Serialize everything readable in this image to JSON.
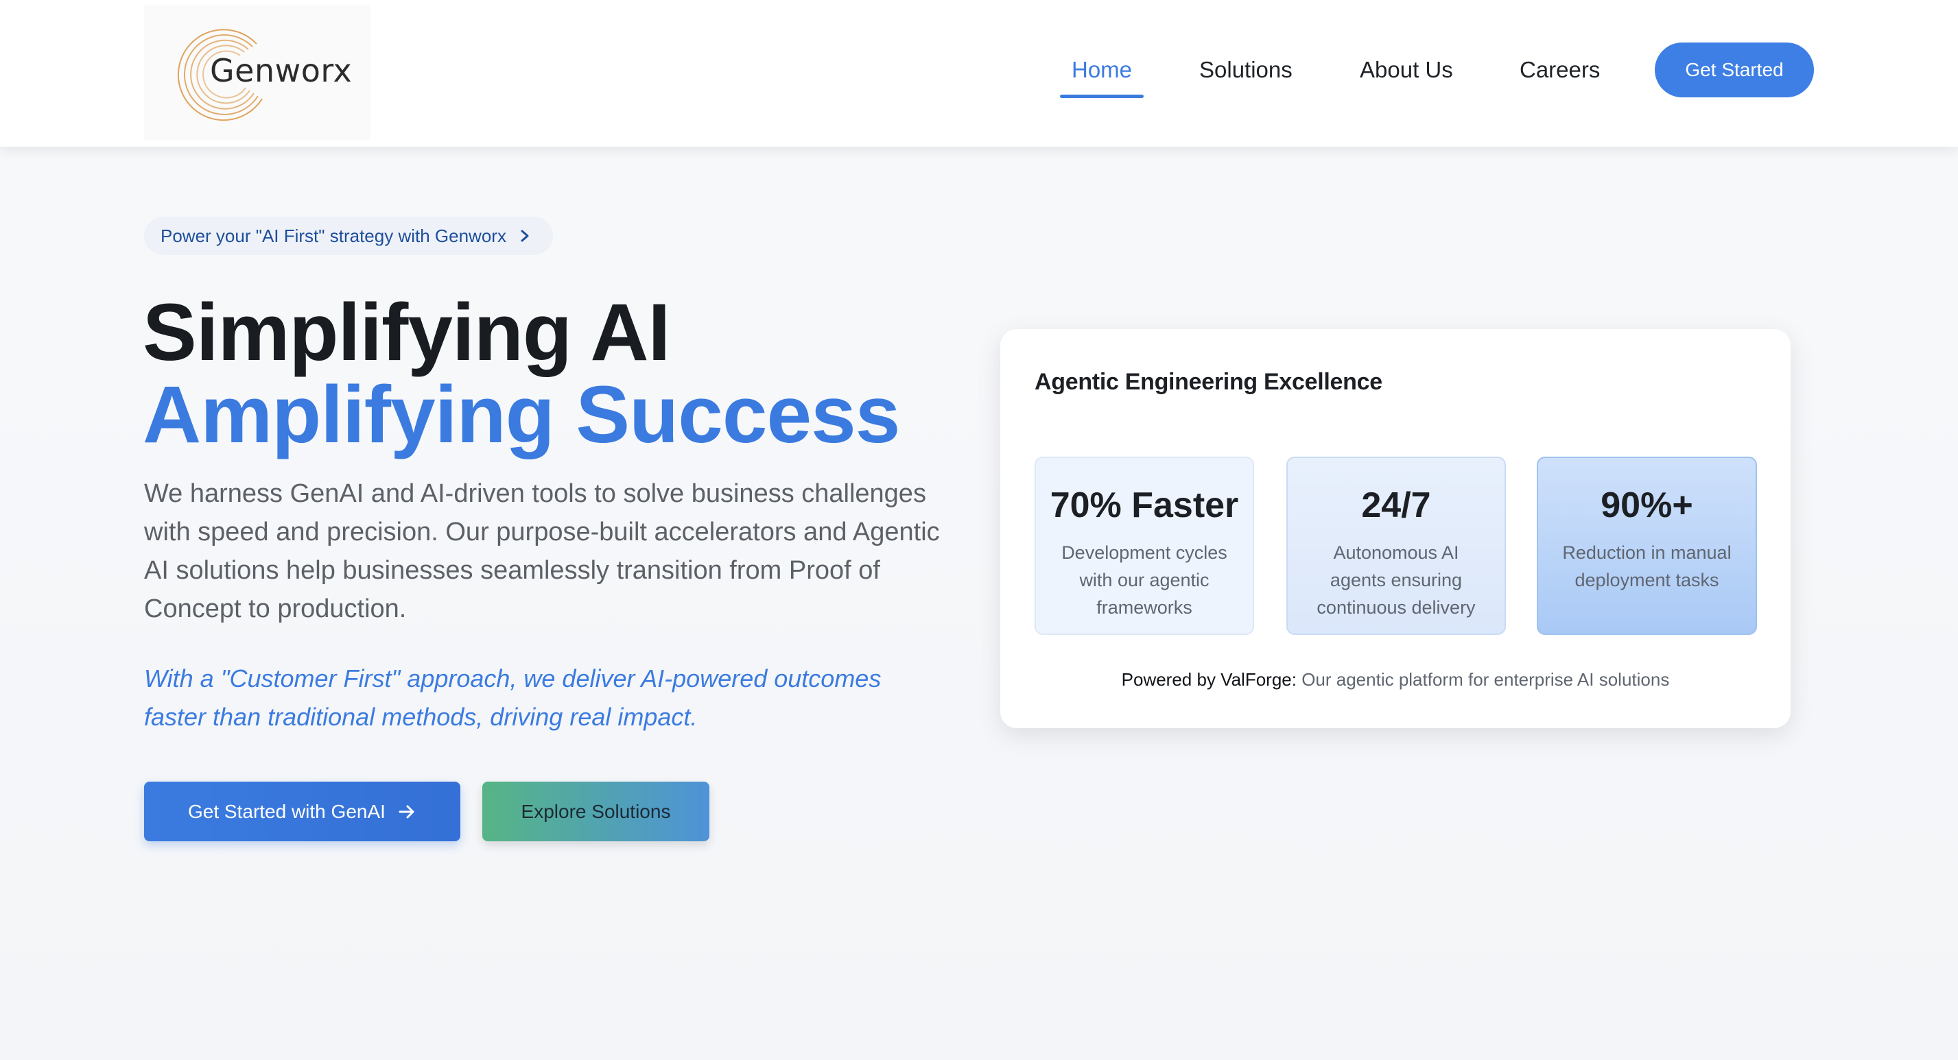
{
  "brand": {
    "name": "Genworx",
    "accent": "#3b7be0",
    "logo_ring_color": "#e0a25c"
  },
  "nav": {
    "items": [
      {
        "label": "Home",
        "active": true
      },
      {
        "label": "Solutions",
        "active": false
      },
      {
        "label": "About Us",
        "active": false
      },
      {
        "label": "Careers",
        "active": false
      }
    ],
    "cta_label": "Get Started"
  },
  "hero": {
    "pill_text": "Power your \"AI First\" strategy with Genworx",
    "pill_icon": "chevron-right-icon",
    "title_line1": "Simplifying AI",
    "title_line2": "Amplifying Success",
    "description": "We harness GenAI and AI-driven tools to solve business challenges with speed and precision. Our purpose-built accelerators and Agentic AI solutions help businesses seamlessly transition from Proof of Concept to production.",
    "quote": "With a \"Customer First\" approach, we deliver AI-powered outcomes faster than traditional methods, driving real impact.",
    "primary_button": "Get Started with GenAI",
    "primary_button_icon": "arrow-right-icon",
    "secondary_button": "Explore Solutions"
  },
  "card": {
    "title": "Agentic Engineering Excellence",
    "stats": [
      {
        "value": "70% Faster",
        "label": "Development cycles with our agentic frameworks"
      },
      {
        "value": "24/7",
        "label": "Autonomous AI agents ensuring continuous delivery"
      },
      {
        "value": "90%+",
        "label": "Reduction in manual deployment tasks"
      }
    ],
    "powered_prefix": "Powered by ValForge:",
    "powered_text": " Our agentic platform for enterprise AI solutions"
  }
}
